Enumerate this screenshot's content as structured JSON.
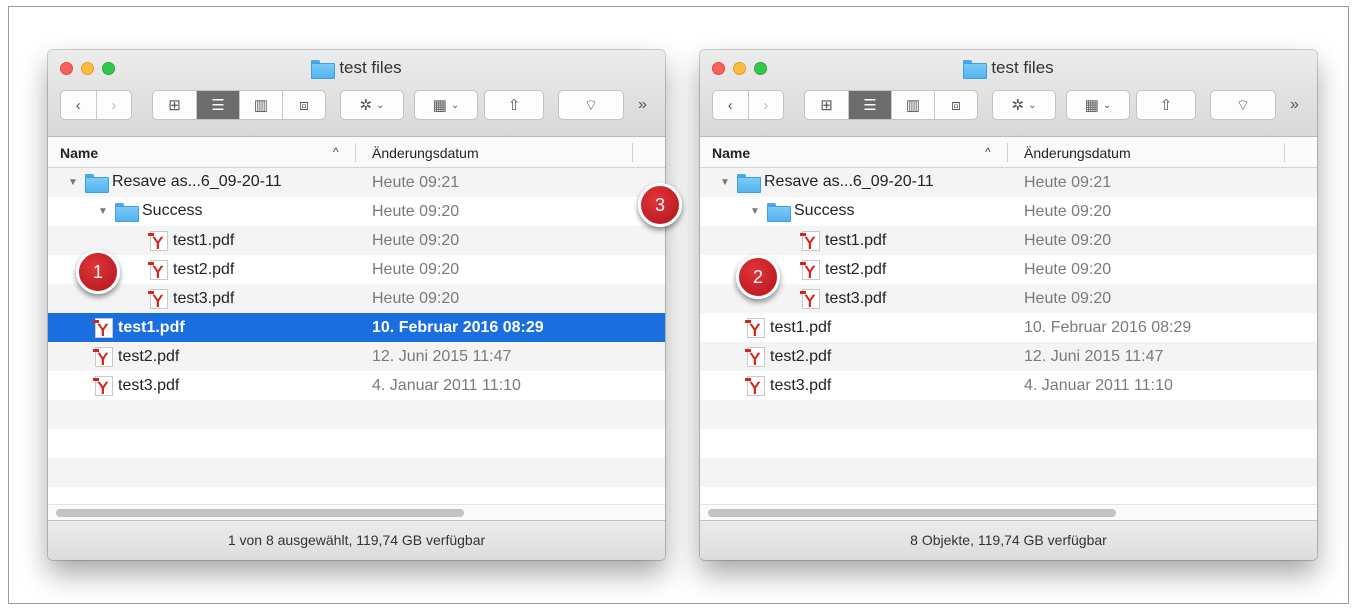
{
  "windows": [
    {
      "title": "test files",
      "header": {
        "name": "Name",
        "sort": "^",
        "date": "Änderungsdatum"
      },
      "rows": [
        {
          "name": "Resave as...6_09-20-11",
          "date": "Heute 09:21",
          "type": "folder",
          "indent": 0,
          "expanded": true
        },
        {
          "name": "Success",
          "date": "Heute 09:20",
          "type": "folder",
          "indent": 1,
          "expanded": true
        },
        {
          "name": "test1.pdf",
          "date": "Heute 09:20",
          "type": "pdf",
          "indent": 2
        },
        {
          "name": "test2.pdf",
          "date": "Heute 09:20",
          "type": "pdf",
          "indent": 2
        },
        {
          "name": "test3.pdf",
          "date": "Heute 09:20",
          "type": "pdf",
          "indent": 2
        },
        {
          "name": "test1.pdf",
          "date": "10. Februar 2016 08:29",
          "type": "pdf",
          "indent": 0,
          "selected": true
        },
        {
          "name": "test2.pdf",
          "date": "12. Juni 2015 11:47",
          "type": "pdf",
          "indent": 0
        },
        {
          "name": "test3.pdf",
          "date": "4. Januar 2011 11:10",
          "type": "pdf",
          "indent": 0
        }
      ],
      "status": "1 von 8 ausgewählt, 119,74 GB verfügbar"
    },
    {
      "title": "test files",
      "header": {
        "name": "Name",
        "sort": "^",
        "date": "Änderungsdatum"
      },
      "rows": [
        {
          "name": "Resave as...6_09-20-11",
          "date": "Heute 09:21",
          "type": "folder",
          "indent": 0,
          "expanded": true
        },
        {
          "name": "Success",
          "date": "Heute 09:20",
          "type": "folder",
          "indent": 1,
          "expanded": true
        },
        {
          "name": "test1.pdf",
          "date": "Heute 09:20",
          "type": "pdf",
          "indent": 2
        },
        {
          "name": "test2.pdf",
          "date": "Heute 09:20",
          "type": "pdf",
          "indent": 2
        },
        {
          "name": "test3.pdf",
          "date": "Heute 09:20",
          "type": "pdf",
          "indent": 2
        },
        {
          "name": "test1.pdf",
          "date": "10. Februar 2016 08:29",
          "type": "pdf",
          "indent": 0
        },
        {
          "name": "test2.pdf",
          "date": "12. Juni 2015 11:47",
          "type": "pdf",
          "indent": 0
        },
        {
          "name": "test3.pdf",
          "date": "4. Januar 2011 11:10",
          "type": "pdf",
          "indent": 0
        }
      ],
      "status": "8 Objekte, 119,74 GB verfügbar"
    }
  ],
  "badges": [
    "1",
    "2",
    "3"
  ],
  "toolbar": {
    "back": "‹",
    "forward": "›",
    "view_icons": "⊞",
    "view_list": "☰",
    "view_columns": "▥",
    "view_cover": "⧈",
    "action": "✲",
    "arrange": "▦",
    "share": "⇧",
    "tag": "⌔",
    "more": "»",
    "caret": "⌄"
  },
  "colors": {
    "selection": "#1a6ee0",
    "badge": "#c51a22",
    "folder": "#5ab7f0"
  }
}
